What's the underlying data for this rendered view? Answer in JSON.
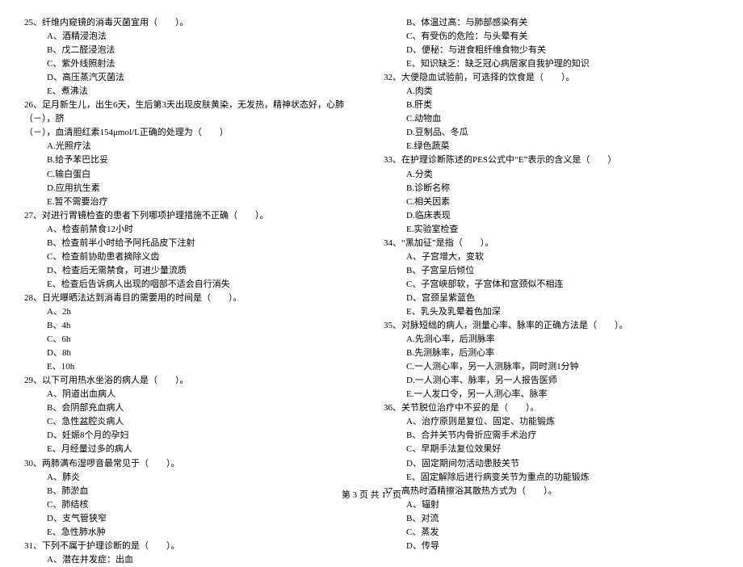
{
  "left": {
    "q25": {
      "stem": "25、纤维内窥镜的消毒灭菌宜用（　　）。",
      "A": "A、酒精浸泡法",
      "B": "B、戊二醛浸泡法",
      "C": "C、紫外线照射法",
      "D": "D、高压蒸汽灭菌法",
      "E": "E、煮沸法"
    },
    "q26": {
      "stem": "26、足月新生儿，出生6天，生后第3天出现皮肤黄染，无发热，精神状态好，心肺（－），脐",
      "stem2": "（－），血清胆红素154μmol/L正确的处理为（　　）",
      "A": "A.光照疗法",
      "B": "B.给予苯巴比妥",
      "C": "C.输白蛋白",
      "D": "D.应用抗生素",
      "E": "E.暂不需要治疗"
    },
    "q27": {
      "stem": "27、对进行胃镜检查的患者下列哪项护理措施不正确（　　）。",
      "A": "A、检查前禁食12小时",
      "B": "B、检查前半小时给予阿托品皮下注射",
      "C": "C、检查前协助患者摘除义齿",
      "D": "D、检查后无需禁食，可进少量流质",
      "E": "E、检查后告诉病人出现的咽部不适会自行消失"
    },
    "q28": {
      "stem": "28、日光曝晒法达到消毒目的需要用的时间是（　　）。",
      "A": "A、2h",
      "B": "B、4h",
      "C": "C、6h",
      "D": "D、8h",
      "E": "E、10h"
    },
    "q29": {
      "stem": "29、以下可用热水坐浴的病人是（　　）。",
      "A": "A、阴道出血病人",
      "B": "B、会阴部充血病人",
      "C": "C、急性盆腔炎病人",
      "D": "D、妊娠8个月的孕妇",
      "E": "E、月经量过多的病人"
    },
    "q30": {
      "stem": "30、两肺满布湿啰音最常见于（　　）。",
      "A": "A、肺炎",
      "B": "B、肺淤血",
      "C": "C、肺结核",
      "D": "D、支气管狭窄",
      "E": "E、急性肺水肿"
    },
    "q31": {
      "stem": "31、下列不属于护理诊断的是（　　）。",
      "A": "A、潜在并发症：出血"
    }
  },
  "right": {
    "q31r": {
      "B": "B、体温过高：与肺部感染有关",
      "C": "C、有受伤的危险：与头晕有关",
      "D": "D、便秘：与进食粗纤维食物少有关",
      "E": "E、知识缺乏：缺乏冠心病居家自我护理的知识"
    },
    "q32": {
      "stem": "32、大便隐血试验前，可选择的饮食是（　　）。",
      "A": "A.肉类",
      "B": "B.肝类",
      "C": "C.动物血",
      "D": "D.豆制品、冬瓜",
      "E": "E.绿色蔬菜"
    },
    "q33": {
      "stem": "33、在护理诊断陈述的PES公式中“E”表示的含义是（　　）",
      "A": "A.分类",
      "B": "B.诊断名称",
      "C": "C.相关因素",
      "D": "D.临床表现",
      "E": "E.实验室检查"
    },
    "q34": {
      "stem": "34、“黑加征”是指（　　）。",
      "A": "A、子宫增大，变软",
      "B": "B、子宫呈后倾位",
      "C": "C、子宫峡部软，子宫体和宫颈似不相连",
      "D": "D、宫颈呈紫蓝色",
      "E": "E、乳头及乳晕着色加深"
    },
    "q35": {
      "stem": "35、对脉短绌的病人，测量心率、脉率的正确方法是（　　）。",
      "A": "A.先测心率，后测脉率",
      "B": "B.先测脉率，后测心率",
      "C": "C.一人测心率，另一人测脉率，同时测1分钟",
      "D": "D.一人测心率、脉率，另一人报告医师",
      "E": "E.一人发口令，另一人测心率、脉率"
    },
    "q36": {
      "stem": "36、关节脱位治疗中不妥的是（　　）。",
      "A": "A、治疗原则是复位、固定、功能锻炼",
      "B": "B、合并关节内骨折应需手术治疗",
      "C": "C、早期手法复位效果好",
      "D": "D、固定期间勿活动患肢关节",
      "E": "E、固定解除后进行病变关节为重点的功能锻炼"
    },
    "q37": {
      "stem": "37、高热时酒精擦浴其散热方式为（　　）。",
      "A": "A、辐射",
      "B": "B、对流",
      "C": "C、蒸发",
      "D": "D、传导"
    }
  },
  "footer": "第 3 页 共 17 页"
}
